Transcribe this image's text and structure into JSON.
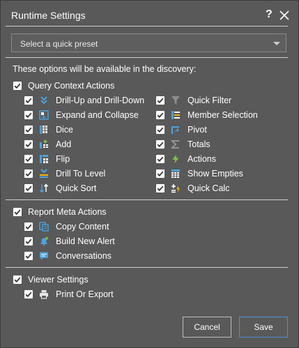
{
  "dialog": {
    "title": "Runtime Settings",
    "help_label": "?"
  },
  "preset": {
    "placeholder": "Select a quick preset"
  },
  "intro": "These options will be available in the discovery:",
  "groups": {
    "query_context": {
      "label": "Query Context Actions",
      "checked": true,
      "left_items": [
        {
          "label": "Drill-Up and Drill-Down",
          "icon": "drill-up-down-icon",
          "checked": true
        },
        {
          "label": "Expand and Collapse",
          "icon": "expand-collapse-icon",
          "checked": true
        },
        {
          "label": "Dice",
          "icon": "dice-icon",
          "checked": true
        },
        {
          "label": "Add",
          "icon": "add-icon",
          "checked": true
        },
        {
          "label": "Flip",
          "icon": "flip-icon",
          "checked": true
        },
        {
          "label": "Drill To Level",
          "icon": "drill-to-level-icon",
          "checked": true
        },
        {
          "label": "Quick Sort",
          "icon": "quick-sort-icon",
          "checked": true
        }
      ],
      "right_items": [
        {
          "label": "Quick Filter",
          "icon": "filter-icon",
          "checked": true
        },
        {
          "label": "Member Selection",
          "icon": "member-selection-icon",
          "checked": true
        },
        {
          "label": "Pivot",
          "icon": "pivot-icon",
          "checked": true
        },
        {
          "label": "Totals",
          "icon": "sigma-icon",
          "checked": true
        },
        {
          "label": "Actions",
          "icon": "lightning-icon",
          "checked": true
        },
        {
          "label": "Show Empties",
          "icon": "grid-dots-icon",
          "checked": true
        },
        {
          "label": "Quick Calc",
          "icon": "quick-calc-icon",
          "checked": true
        }
      ]
    },
    "report_meta": {
      "label": "Report Meta Actions",
      "checked": true,
      "items": [
        {
          "label": "Copy Content",
          "icon": "copy-content-icon",
          "checked": true
        },
        {
          "label": "Build New Alert",
          "icon": "alert-bell-icon",
          "checked": true
        },
        {
          "label": "Conversations",
          "icon": "conversation-icon",
          "checked": true
        }
      ]
    },
    "viewer": {
      "label": "Viewer Settings",
      "checked": true,
      "items": [
        {
          "label": "Print Or Export",
          "icon": "printer-icon",
          "checked": true
        }
      ]
    }
  },
  "buttons": {
    "cancel": "Cancel",
    "save": "Save"
  },
  "colors": {
    "background": "#595959",
    "accent": "#4f8fd6",
    "icon_blue": "#4aa3df",
    "icon_green": "#7ac943",
    "icon_yellow": "#f5b800"
  }
}
